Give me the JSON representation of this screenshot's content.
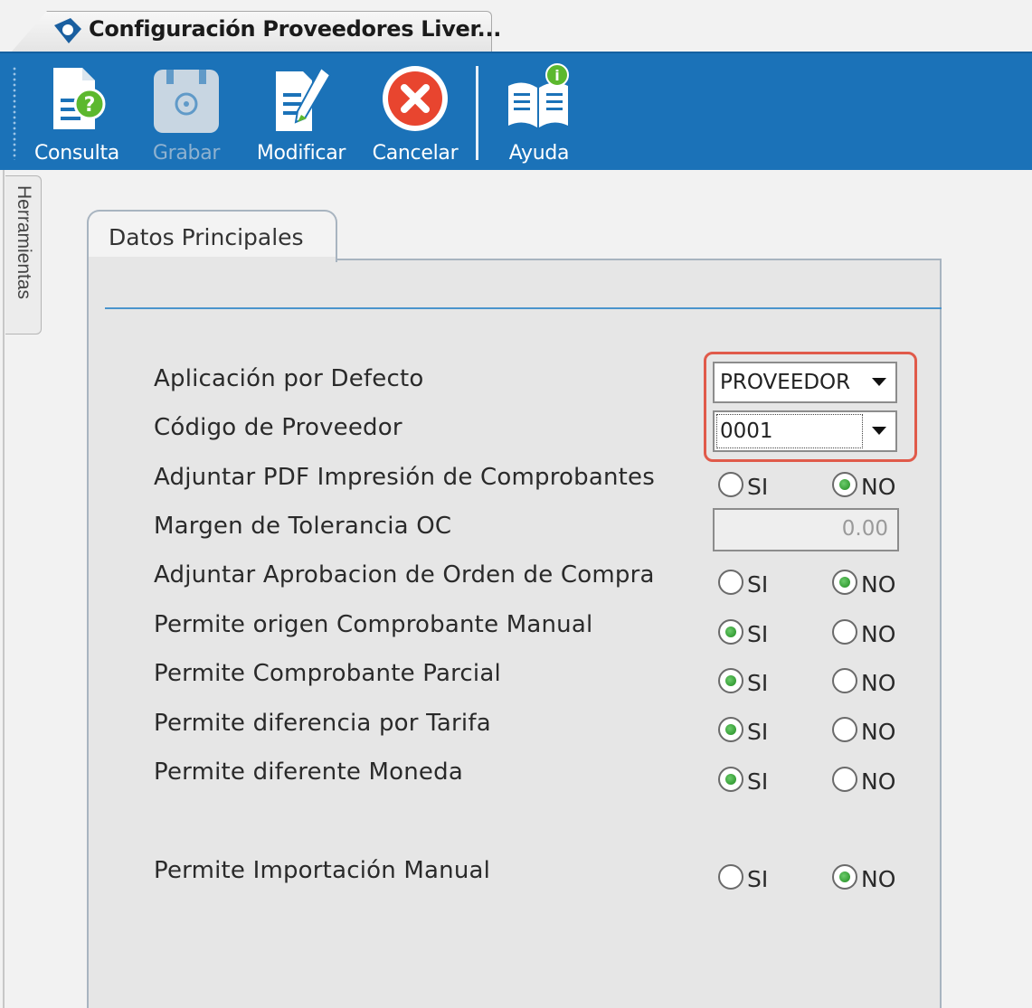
{
  "window": {
    "tab_title": "Configuración Proveedores Liver..."
  },
  "toolbar": {
    "buttons": [
      {
        "label": "Consulta",
        "icon": "document-question-icon",
        "enabled": true
      },
      {
        "label": "Grabar",
        "icon": "disk-save-icon",
        "enabled": false
      },
      {
        "label": "Modificar",
        "icon": "document-edit-icon",
        "enabled": true
      },
      {
        "label": "Cancelar",
        "icon": "cancel-x-icon",
        "enabled": true
      },
      {
        "label": "Ayuda",
        "icon": "help-book-icon",
        "enabled": true
      }
    ]
  },
  "side_tab": {
    "label": "Herramientas"
  },
  "panel": {
    "tab_label": "Datos Principales",
    "rows": [
      {
        "label": "Aplicación por Defecto",
        "control": "combo",
        "value": "PROVEEDOR"
      },
      {
        "label": "Código de Proveedor",
        "control": "combo",
        "value": "0001"
      },
      {
        "label": "Adjuntar PDF Impresión de Comprobantes",
        "control": "radio",
        "selected": "NO"
      },
      {
        "label": "Margen de Tolerancia OC",
        "control": "number",
        "value": "0.00"
      },
      {
        "label": "Adjuntar Aprobacion de Orden de Compra",
        "control": "radio",
        "selected": "NO"
      },
      {
        "label": "Permite origen Comprobante Manual",
        "control": "radio",
        "selected": "SI"
      },
      {
        "label": "Permite Comprobante Parcial",
        "control": "radio",
        "selected": "SI"
      },
      {
        "label": "Permite diferencia por Tarifa",
        "control": "radio",
        "selected": "SI"
      },
      {
        "label": "Permite diferente Moneda",
        "control": "radio",
        "selected": "SI"
      },
      {
        "label": "Permite Importación Manual",
        "control": "radio",
        "selected": "NO"
      }
    ],
    "radio_labels": {
      "yes": "SI",
      "no": "NO"
    }
  },
  "colors": {
    "toolbar_bg": "#1b72b8",
    "highlight": "#e05a4a",
    "radio_selected": "#1f8a1f",
    "panel_line": "#4a94cc"
  }
}
